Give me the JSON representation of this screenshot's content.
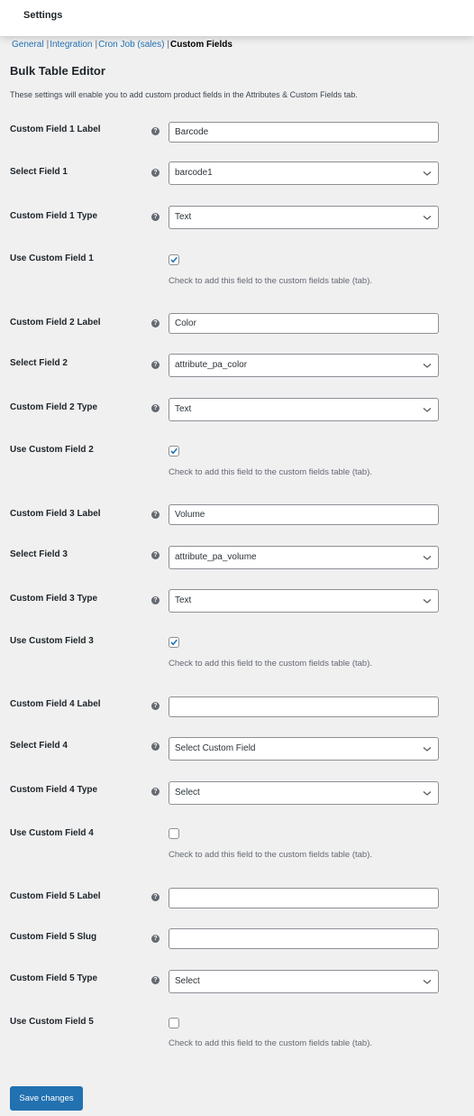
{
  "header": {
    "title": "Settings"
  },
  "subnav": {
    "items": [
      {
        "label": "General",
        "current": false
      },
      {
        "label": "Integration",
        "current": false
      },
      {
        "label": "Cron Job (sales)",
        "current": false
      },
      {
        "label": "Custom Fields",
        "current": true
      }
    ],
    "separator": "|"
  },
  "section": {
    "title": "Bulk Table Editor",
    "intro": "These settings will enable you to add custom product fields in the Attributes & Custom Fields tab."
  },
  "help_icon_glyph": "?",
  "checkbox_description": "Check to add this field to the custom fields table (tab).",
  "fields": {
    "f1_label": {
      "label": "Custom Field 1 Label",
      "value": "Barcode"
    },
    "f1_select": {
      "label": "Select Field 1",
      "value": "barcode1"
    },
    "f1_type": {
      "label": "Custom Field 1 Type",
      "value": "Text"
    },
    "f1_use": {
      "label": "Use Custom Field 1",
      "checked": true
    },
    "f2_label": {
      "label": "Custom Field 2 Label",
      "value": "Color"
    },
    "f2_select": {
      "label": "Select Field 2",
      "value": "attribute_pa_color"
    },
    "f2_type": {
      "label": "Custom Field 2 Type",
      "value": "Text"
    },
    "f2_use": {
      "label": "Use Custom Field 2",
      "checked": true
    },
    "f3_label": {
      "label": "Custom Field 3 Label",
      "value": "Volume"
    },
    "f3_select": {
      "label": "Select Field 3",
      "value": "attribute_pa_volume"
    },
    "f3_type": {
      "label": "Custom Field 3 Type",
      "value": "Text"
    },
    "f3_use": {
      "label": "Use Custom Field 3",
      "checked": true
    },
    "f4_label": {
      "label": "Custom Field 4 Label",
      "value": ""
    },
    "f4_select": {
      "label": "Select Field 4",
      "value": "Select Custom Field"
    },
    "f4_type": {
      "label": "Custom Field 4 Type",
      "value": "Select"
    },
    "f4_use": {
      "label": "Use Custom Field 4",
      "checked": false
    },
    "f5_label": {
      "label": "Custom Field 5 Label",
      "value": ""
    },
    "f5_slug": {
      "label": "Custom Field 5 Slug",
      "value": ""
    },
    "f5_type": {
      "label": "Custom Field 5 Type",
      "value": "Select"
    },
    "f5_use": {
      "label": "Use Custom Field 5",
      "checked": false
    }
  },
  "actions": {
    "save_label": "Save changes"
  },
  "colors": {
    "accent": "#2271b1",
    "background": "#f0f0f1"
  }
}
